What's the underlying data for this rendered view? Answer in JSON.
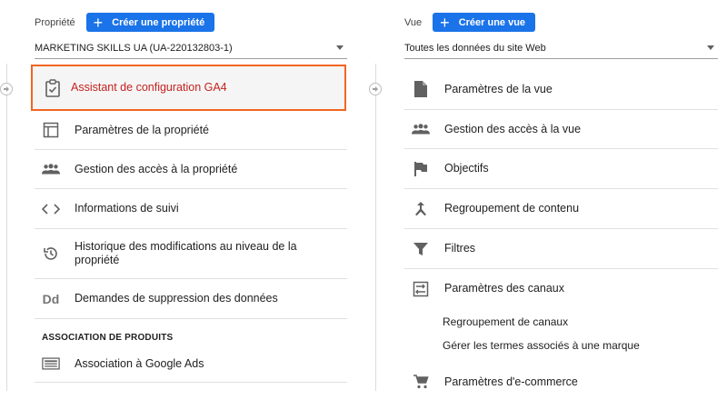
{
  "property": {
    "label": "Propriété",
    "create_button": "Créer une propriété",
    "selected": "MARKETING SKILLS UA (UA-220132803-1)",
    "items": [
      {
        "label": "Assistant de configuration GA4",
        "icon": "clipboard-check-icon"
      },
      {
        "label": "Paramètres de la propriété",
        "icon": "layout-icon"
      },
      {
        "label": "Gestion des accès à la propriété",
        "icon": "people-icon"
      },
      {
        "label": "Informations de suivi",
        "icon": "code-icon"
      },
      {
        "label": "Historique des modifications au niveau de la propriété",
        "icon": "history-icon"
      },
      {
        "label": "Demandes de suppression des données",
        "icon": "dd-icon",
        "icon_text": "Dd"
      }
    ],
    "section_title": "ASSOCIATION DE PRODUITS",
    "links": [
      {
        "label": "Association à Google Ads",
        "icon": "ads-panel-icon"
      }
    ]
  },
  "view": {
    "label": "Vue",
    "create_button": "Créer une vue",
    "selected": "Toutes les données du site Web",
    "items": [
      {
        "label": "Paramètres de la vue",
        "icon": "document-icon"
      },
      {
        "label": "Gestion des accès à la vue",
        "icon": "people-icon"
      },
      {
        "label": "Objectifs",
        "icon": "flag-icon"
      },
      {
        "label": "Regroupement de contenu",
        "icon": "merge-icon"
      },
      {
        "label": "Filtres",
        "icon": "filter-icon"
      },
      {
        "label": "Paramètres des canaux",
        "icon": "channels-icon"
      }
    ],
    "channel_subitems": [
      "Regroupement de canaux",
      "Gérer les termes associés à une marque"
    ],
    "ecommerce": {
      "label": "Paramètres d'e-commerce",
      "icon": "cart-icon"
    }
  },
  "colors": {
    "accent": "#1a73e8",
    "highlight_border": "#f26522",
    "highlight_text": "#c5221f",
    "icon": "#616161"
  }
}
